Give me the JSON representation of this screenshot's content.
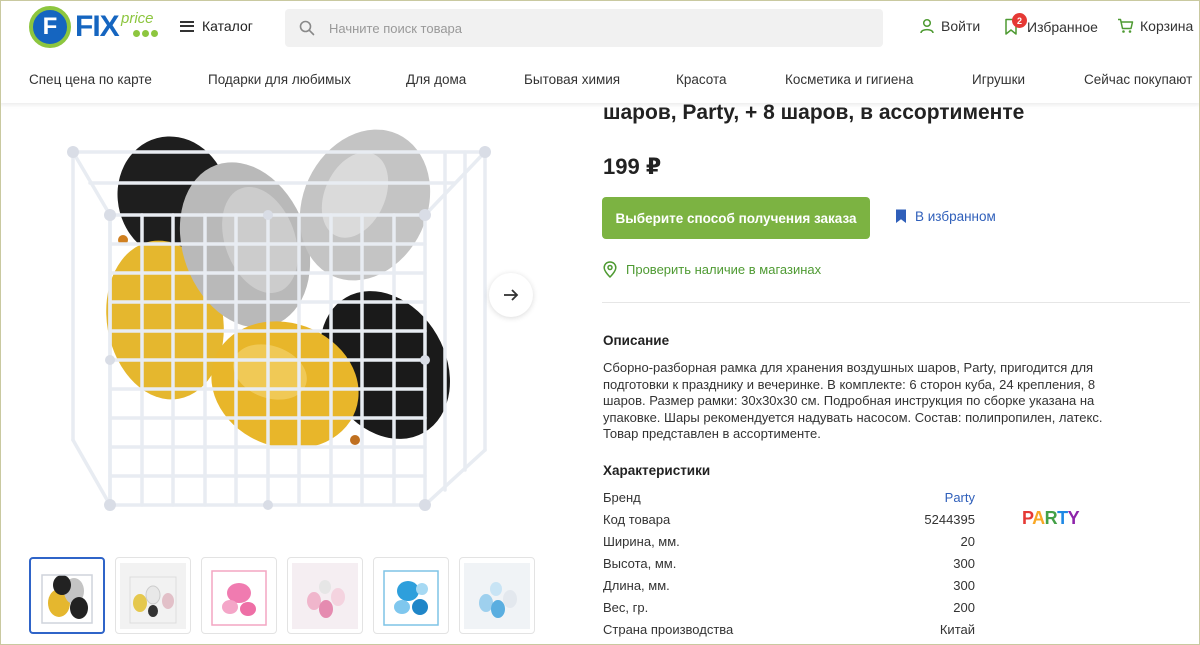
{
  "header": {
    "logo_text": "FIX",
    "logo_price": "price",
    "catalog_label": "Каталог",
    "search_placeholder": "Начните поиск товара",
    "login_label": "Войти",
    "favorites_label": "Избранное",
    "favorites_count": "2",
    "cart_label": "Корзина"
  },
  "nav": {
    "items": [
      "Спец цена по карте",
      "Подарки для любимых",
      "Для дома",
      "Бытовая химия",
      "Красота",
      "Косметика и гигиена",
      "Игрушки",
      "Сейчас покупают"
    ]
  },
  "product": {
    "title_visible": "шаров, Party, + 8 шаров, в ассортименте",
    "price": "199 ₽",
    "order_button": "Выберите способ получения заказа",
    "favorite_link": "В избранном",
    "stock_link": "Проверить наличие в магазинах",
    "description_heading": "Описание",
    "description": "Сборно-разборная рамка для хранения воздушных шаров, Party, пригодится для подготовки к празднику и вечеринке. В комплекте: 6 сторон куба, 24 крепления, 8 шаров. Размер рамки: 30х30х30 см. Подробная инструкция по сборке указана на упаковке. Шары рекомендуется надувать насосом. Состав: полипропилен, латекс. Товар представлен в ассортименте.",
    "specs_heading": "Характеристики",
    "specs": [
      {
        "label": "Бренд",
        "value": "Party"
      },
      {
        "label": "Код товара",
        "value": "5244395"
      },
      {
        "label": "Ширина, мм.",
        "value": "20"
      },
      {
        "label": "Высота, мм.",
        "value": "300"
      },
      {
        "label": "Длина, мм.",
        "value": "300"
      },
      {
        "label": "Вес, гр.",
        "value": "200"
      },
      {
        "label": "Страна производства",
        "value": "Китай"
      }
    ],
    "brand_logo_text": "PARTY"
  },
  "gallery": {
    "next_icon": "arrow-right-icon",
    "thumbnails": [
      "gold-black-silver",
      "white-gold-black",
      "pink",
      "pink-white",
      "blue",
      "white-blue"
    ]
  },
  "colors": {
    "accent_green": "#7cb342",
    "link_blue": "#2f5fba",
    "brand_blue": "#1565c0",
    "badge_red": "#e53935"
  }
}
